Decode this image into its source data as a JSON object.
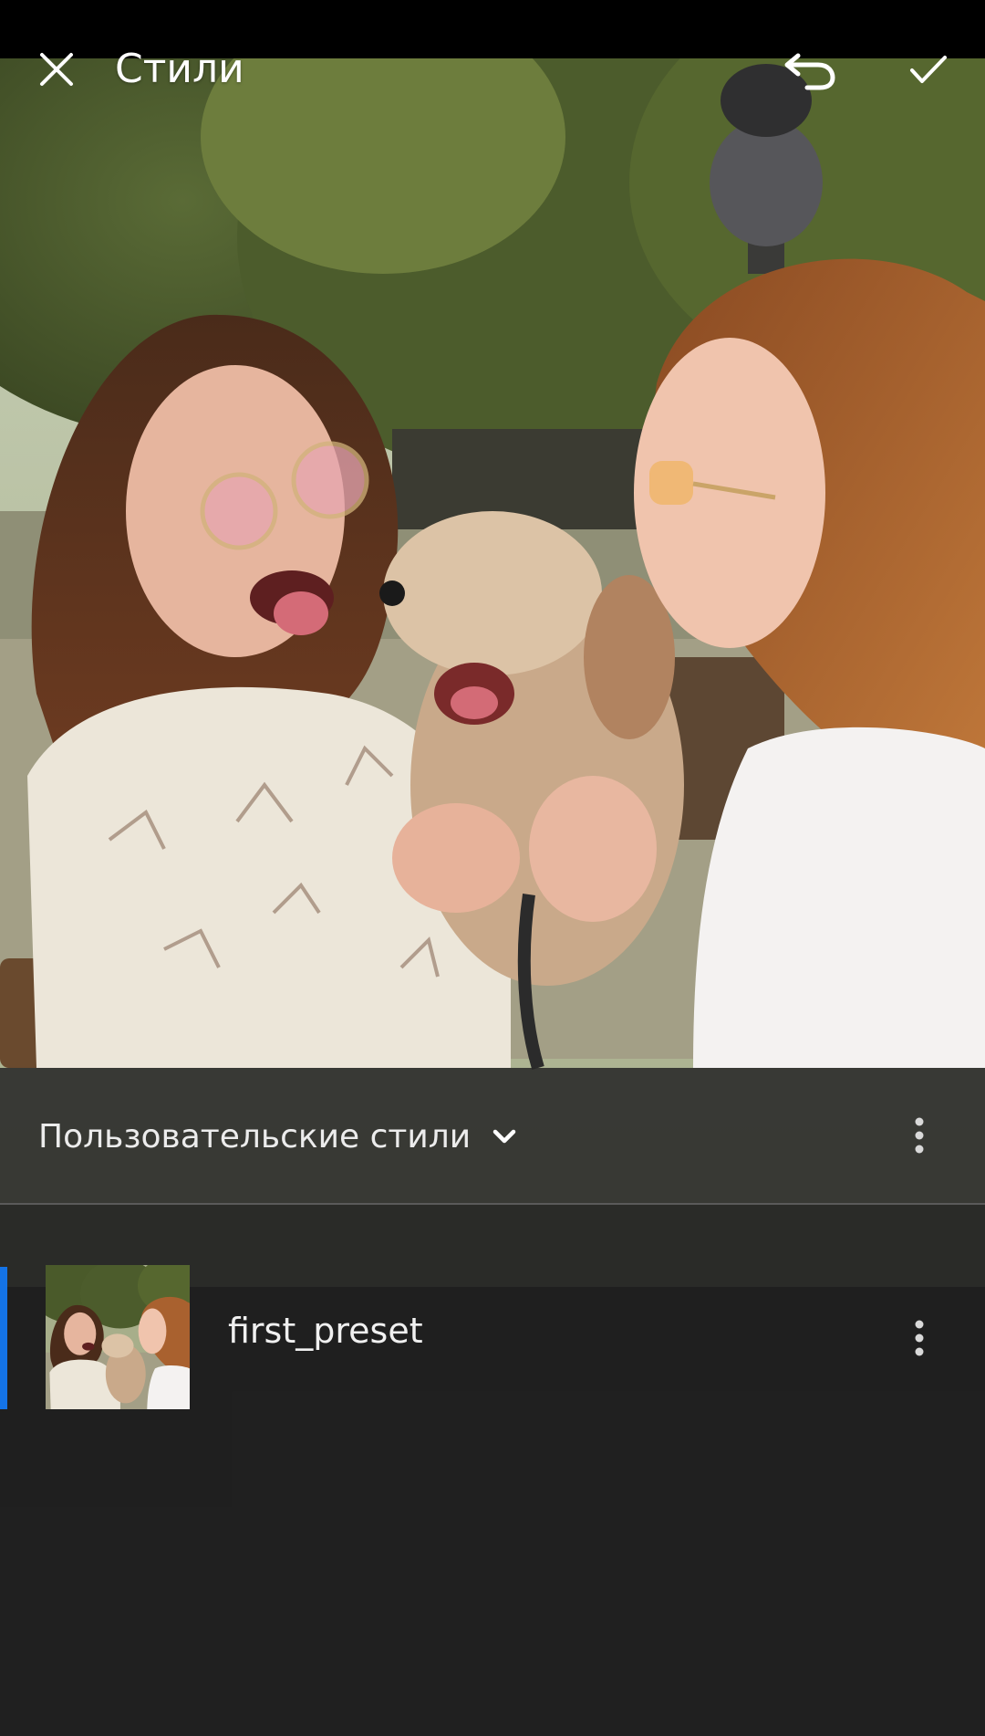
{
  "app": {
    "title": "Стили"
  },
  "toolbar": {
    "close_icon": "close-icon",
    "undo_icon": "undo-icon",
    "confirm_icon": "checkmark-icon"
  },
  "presets_panel": {
    "category_label": "Пользовательские стили",
    "category_icon": "chevron-down-icon",
    "more_icon": "more-vertical-icon",
    "items": [
      {
        "name": "first_preset",
        "selected": true,
        "more_icon": "more-vertical-icon"
      }
    ]
  },
  "colors": {
    "accent": "#1473e6",
    "panel_background": "#202020",
    "status_bar": "#000000"
  }
}
